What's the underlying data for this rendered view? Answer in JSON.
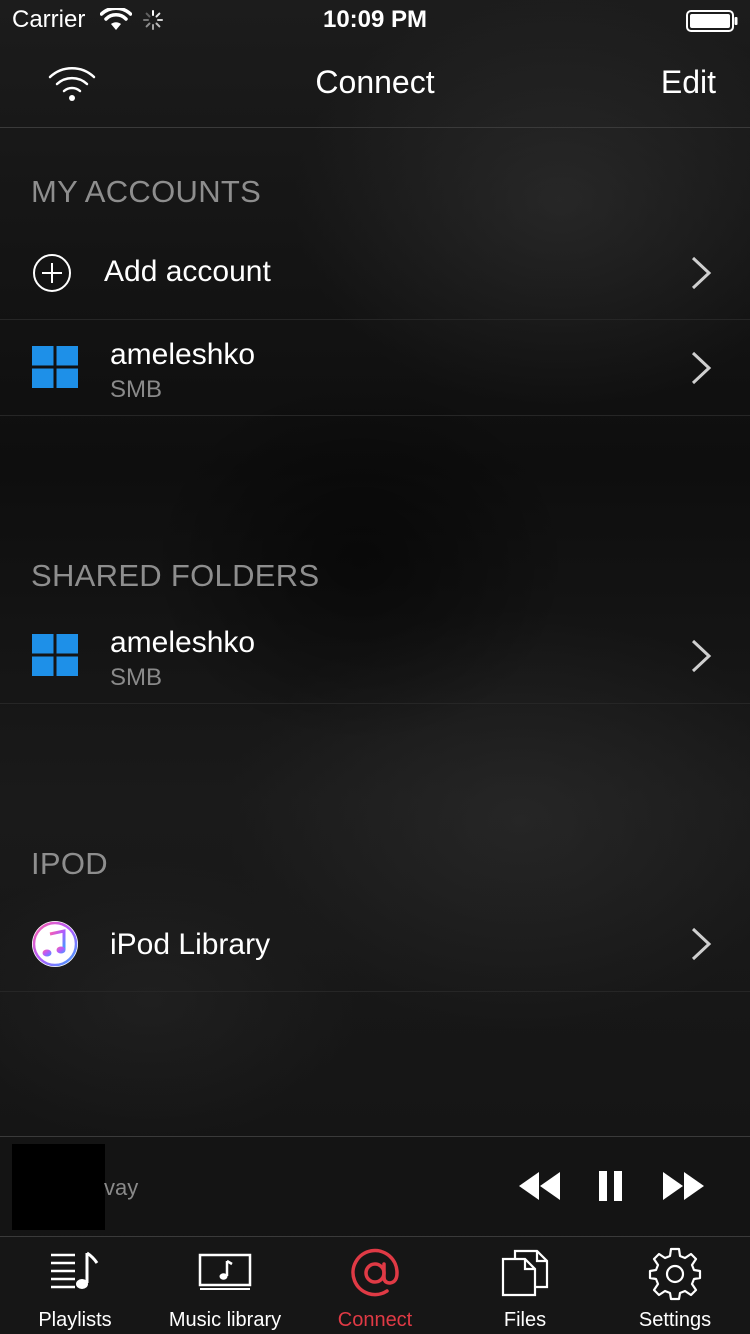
{
  "status_bar": {
    "carrier": "Carrier",
    "time": "10:09 PM"
  },
  "nav": {
    "title": "Connect",
    "edit_label": "Edit"
  },
  "sections": {
    "my_accounts": {
      "header": "MY ACCOUNTS",
      "add_account_label": "Add account",
      "account": {
        "title": "ameleshko",
        "subtitle": "SMB"
      }
    },
    "shared_folders": {
      "header": "SHARED FOLDERS",
      "folder": {
        "title": "ameleshko",
        "subtitle": "SMB"
      }
    },
    "ipod": {
      "header": "IPOD",
      "library": {
        "title": "iPod Library"
      }
    }
  },
  "mini_player": {
    "track_title": "vay"
  },
  "tabs": [
    {
      "label": "Playlists",
      "icon": "playlist-icon"
    },
    {
      "label": "Music library",
      "icon": "music-library-icon"
    },
    {
      "label": "Connect",
      "icon": "at-sign-icon",
      "active": true
    },
    {
      "label": "Files",
      "icon": "files-icon"
    },
    {
      "label": "Settings",
      "icon": "gear-icon"
    }
  ],
  "colors": {
    "accent": "#e03a45",
    "windows_blue": "#1e90e8",
    "background": "#141414"
  }
}
